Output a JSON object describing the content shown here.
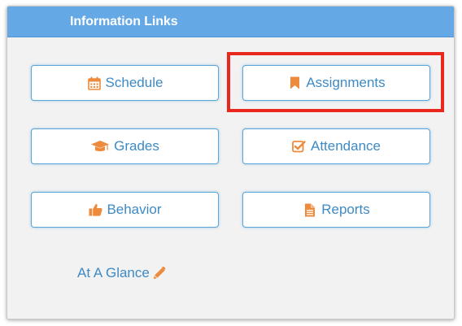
{
  "panel": {
    "title": "Information Links"
  },
  "links": [
    {
      "id": "schedule",
      "label": "Schedule",
      "icon": "calendar-icon"
    },
    {
      "id": "assignments",
      "label": "Assignments",
      "icon": "bookmark-icon"
    },
    {
      "id": "grades",
      "label": "Grades",
      "icon": "graduation-cap-icon"
    },
    {
      "id": "attendance",
      "label": "Attendance",
      "icon": "checkbox-icon"
    },
    {
      "id": "behavior",
      "label": "Behavior",
      "icon": "thumbs-up-icon"
    },
    {
      "id": "reports",
      "label": "Reports",
      "icon": "document-icon"
    }
  ],
  "at_a_glance": {
    "label": "At A Glance",
    "icon": "pencil-icon"
  },
  "colors": {
    "header": "#64a9e6",
    "link_text": "#3e8ac5",
    "icon": "#ee8a3c",
    "highlight": "#e8281c",
    "panel_bg": "#f2f2f2"
  }
}
